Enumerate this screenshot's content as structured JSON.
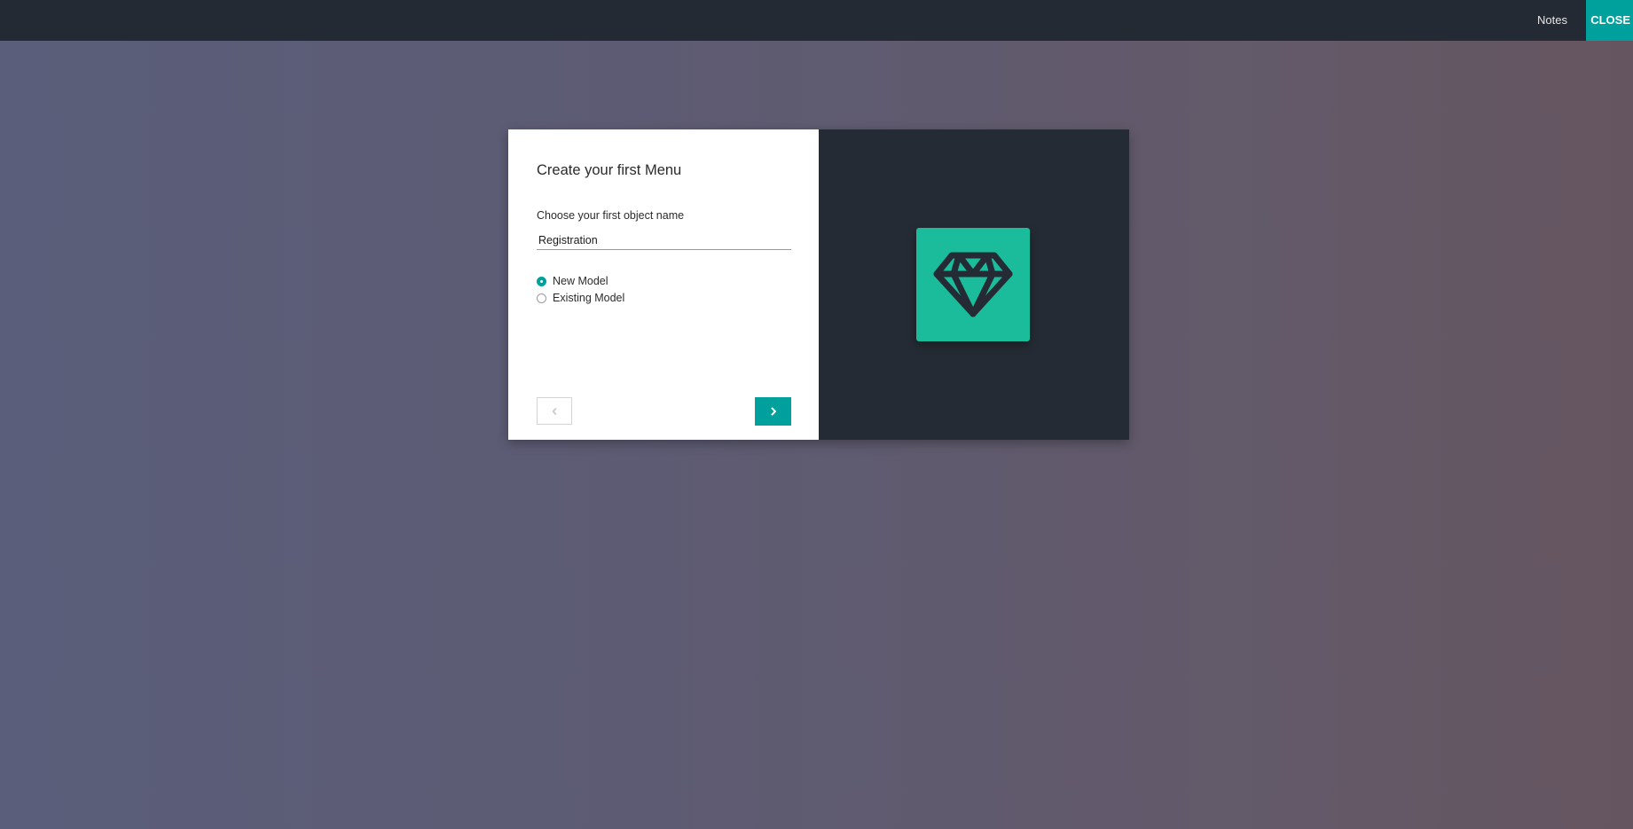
{
  "topbar": {
    "notes_label": "Notes",
    "close_label": "CLOSE"
  },
  "dialog": {
    "title": "Create your first Menu",
    "field_label": "Choose your first object name",
    "object_name_value": "Registration",
    "model_options": [
      {
        "label": "New Model",
        "selected": true
      },
      {
        "label": "Existing Model",
        "selected": false
      }
    ],
    "prev_icon": "chevron-left-icon",
    "next_icon": "chevron-right-icon",
    "app_icon": "diamond-icon"
  },
  "colors": {
    "accent": "#00a09d",
    "topbar": "#242a33",
    "dialog_right_panel": "#252b34",
    "app_icon_bg": "#1abc9c"
  }
}
